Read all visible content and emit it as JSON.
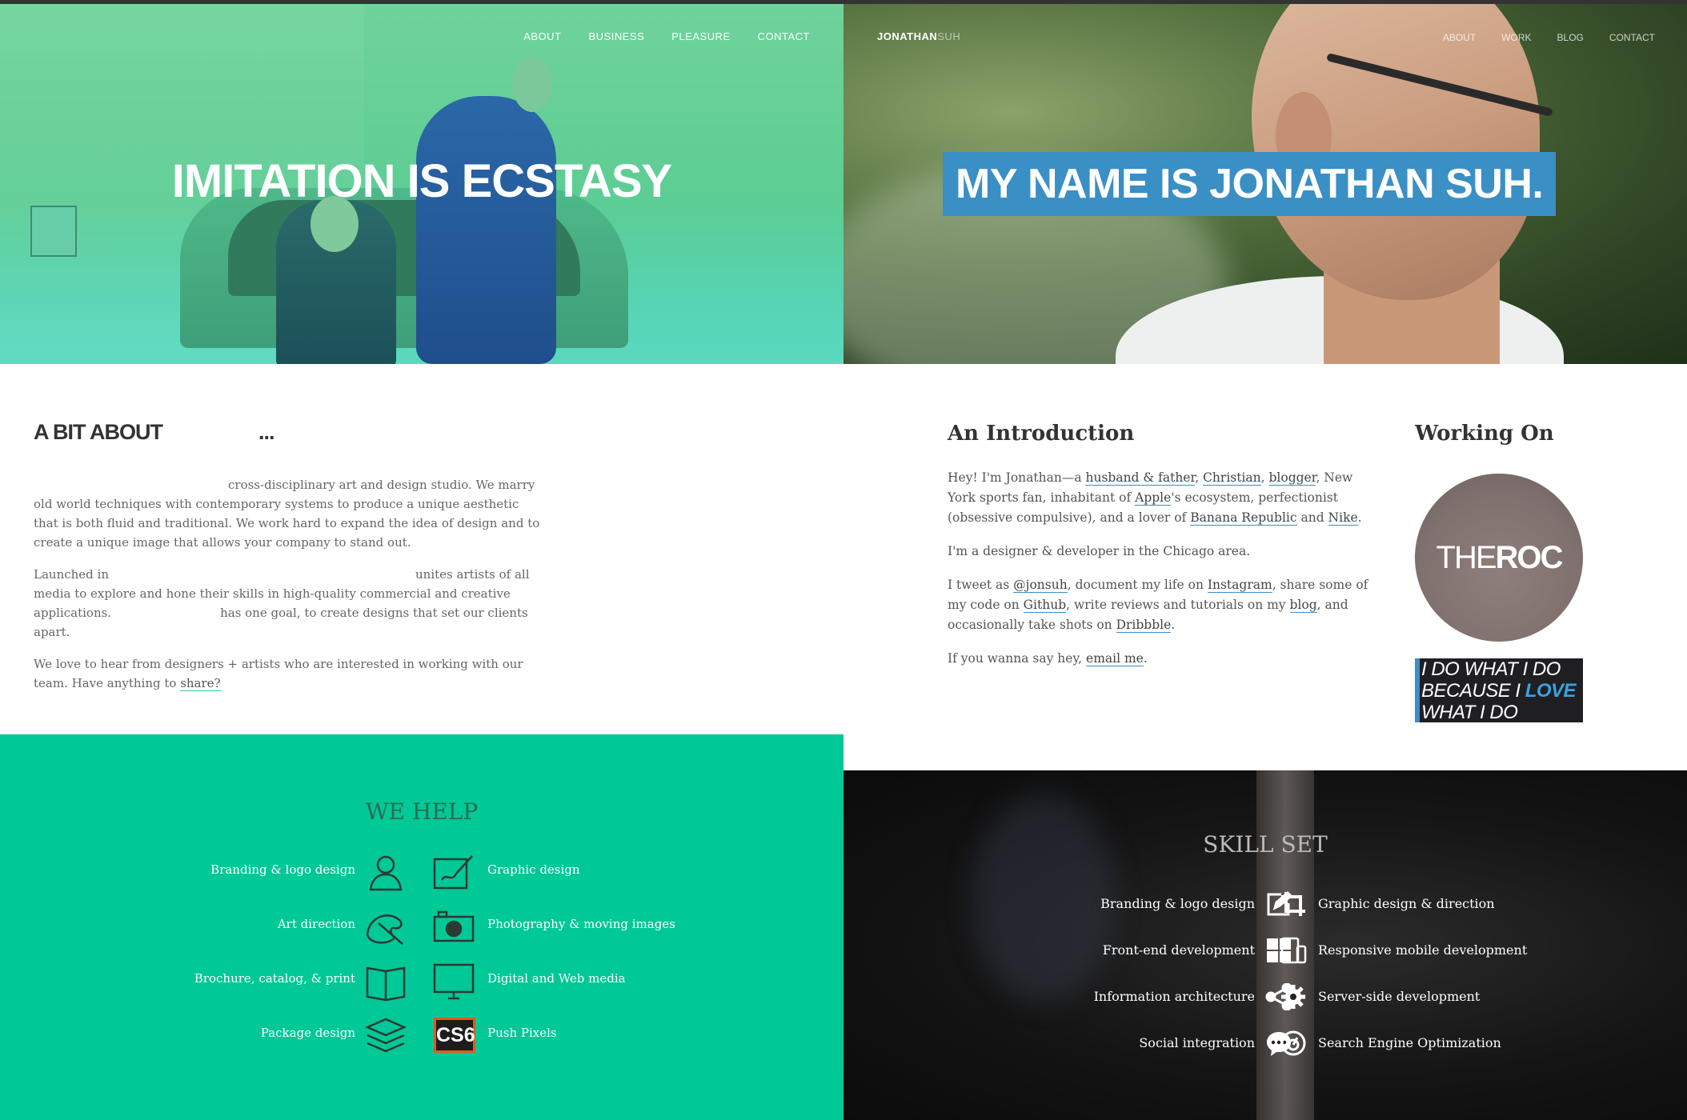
{
  "left": {
    "nav": [
      "ABOUT",
      "BUSINESS",
      "PLEASURE",
      "CONTACT"
    ],
    "hero_title": "IMITATION IS ECSTASY",
    "about": {
      "heading": "A BIT ABOUT",
      "heading_suffix": "...",
      "p1": "cross-disciplinary art and design studio. We marry old world techniques with contemporary systems to produce a unique aesthetic that is both fluid and traditional. We work hard to expand the idea of design and to create a unique image that allows your company to stand out.",
      "p2a": "Launched in",
      "p2b": "unites artists of all media to explore and hone their skills in high-quality commercial and creative applications.",
      "p2c": "has one goal, to create designs that set our clients apart.",
      "p3": "We love to hear from designers + artists who are interested in working with our team. Have anything to",
      "p3_link": "share?"
    },
    "help": {
      "heading": "WE HELP",
      "items_left": [
        "Branding & logo design",
        "Art direction",
        "Brochure, catalog, & print",
        "Package design"
      ],
      "items_right": [
        "Graphic design",
        "Photography & moving images",
        "Digital and Web media",
        "Push Pixels"
      ],
      "cs6_label": "CS6",
      "icons_left": [
        "person-bust-icon",
        "paint-palette-icon",
        "open-book-icon",
        "layers-stack-icon"
      ],
      "icons_right": [
        "pen-on-canvas-icon",
        "camera-icon",
        "monitor-icon",
        "cs6-icon"
      ]
    }
  },
  "right": {
    "brand_bold": "JONATHAN",
    "brand_thin": "SUH",
    "nav": [
      "ABOUT",
      "WORK",
      "BLOG",
      "CONTACT"
    ],
    "hero_title": "MY NAME IS JONATHAN SUH.",
    "intro": {
      "heading": "An Introduction",
      "p1": {
        "t1": "Hey! I'm Jonathan—a ",
        "l1": "husband & father",
        "t2": ", ",
        "l2": "Christian",
        "t3": ", ",
        "l3": "blogger",
        "t4": ", New York sports fan, inhabitant of ",
        "l4": "Apple",
        "t5": "'s ecosystem, perfectionist (obsessive compulsive), and a lover of ",
        "l5": "Banana Republic",
        "t6": " and ",
        "l6": "Nike",
        "t7": "."
      },
      "p2": "I'm a designer & developer in the Chicago area.",
      "p3": {
        "t1": "I tweet as ",
        "l1": "@jonsuh",
        "t2": ", document my life on ",
        "l2": "Instagram",
        "t3": ", share some of my code on ",
        "l3": "Github",
        "t4": ", write reviews and tutorials on my ",
        "l4": "blog",
        "t5": ", and occasionally take shots on ",
        "l5": "Dribbble",
        "t6": "."
      },
      "p4": {
        "t1": "If you wanna say hey, ",
        "l1": "email me",
        "t2": "."
      }
    },
    "working_on": {
      "heading": "Working On",
      "logo_thin": "THE",
      "logo_bold": "ROC",
      "quote_1": "I DO WHAT I DO",
      "quote_2a": "BECAUSE I ",
      "quote_2b": "LOVE",
      "quote_3": "WHAT I DO"
    },
    "skills": {
      "heading": "SKILL SET",
      "items_left": [
        "Branding & logo design",
        "Front-end development",
        "Information architecture",
        "Social integration"
      ],
      "items_right": [
        "Graphic design & direction",
        "Responsive mobile development",
        "Server-side development",
        "Search Engine Optimization"
      ],
      "icons_left": [
        "edit-icon",
        "grid-icon",
        "share-icon",
        "chat-bubble-icon"
      ],
      "icons_right": [
        "crop-icon",
        "devices-icon",
        "gear-icon",
        "speedometer-icon"
      ]
    }
  },
  "colors": {
    "left_accent": "#00c896",
    "right_accent": "#3a8fc5"
  }
}
